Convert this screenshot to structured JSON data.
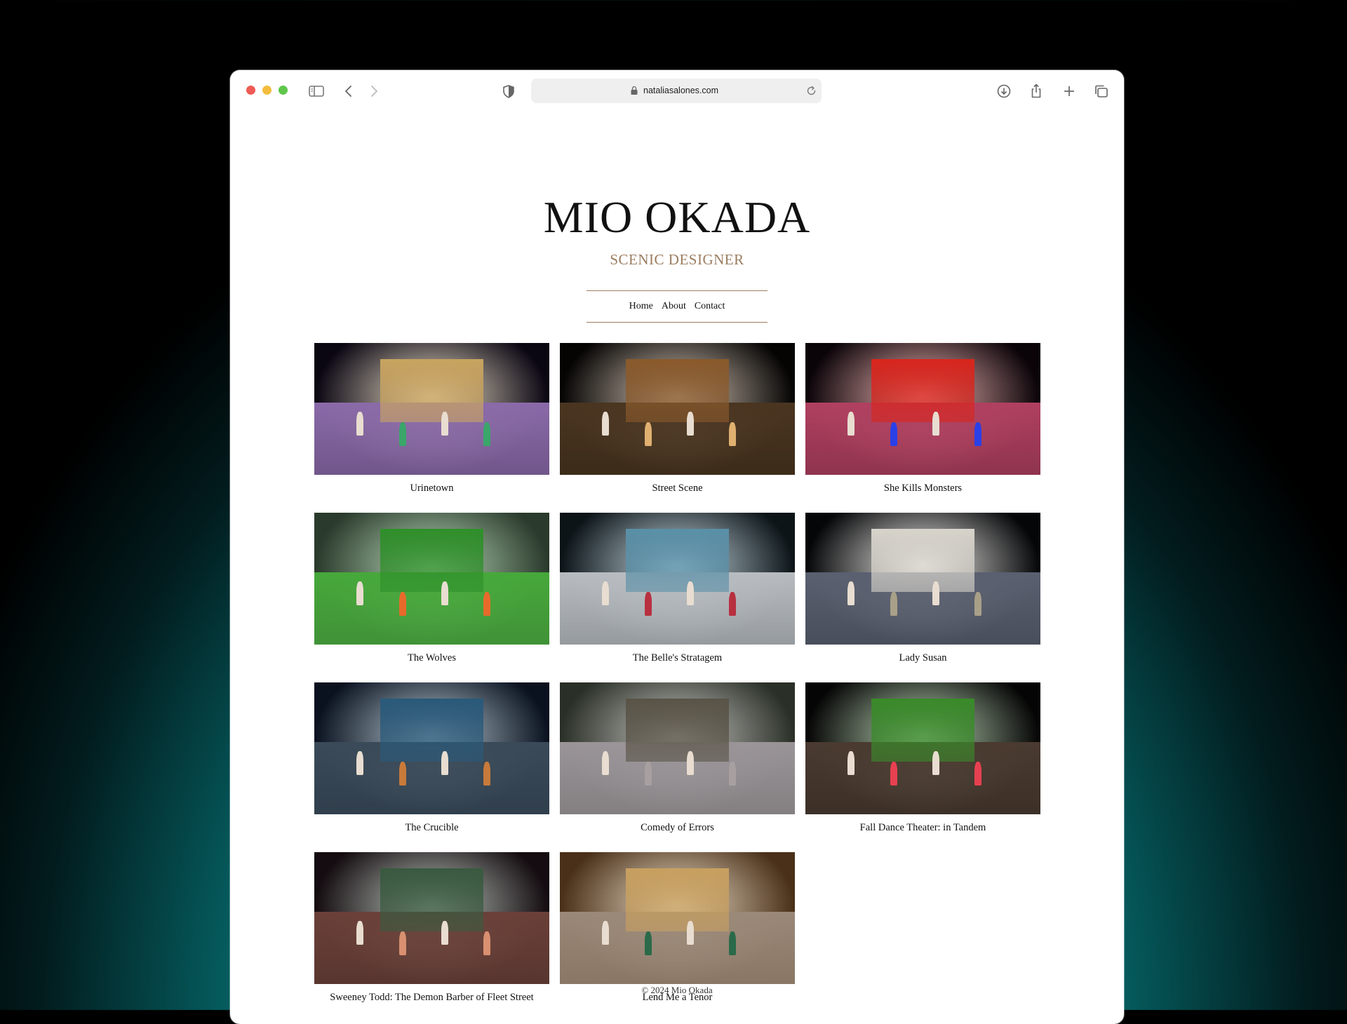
{
  "browser": {
    "url": "nataliasalones.com"
  },
  "site": {
    "title": "MIO OKADA",
    "subtitle": "SCENIC DESIGNER"
  },
  "nav": {
    "items": [
      "Home",
      "About",
      "Contact"
    ]
  },
  "productions": [
    {
      "title": "Urinetown",
      "palette": {
        "sky": "#0a0612",
        "stage": "#8a6aa8",
        "set": "#c9a460",
        "accent": "#3aa66a"
      }
    },
    {
      "title": "Street Scene",
      "palette": {
        "sky": "#050403",
        "stage": "#4a3520",
        "set": "#8a5a2c",
        "accent": "#e0b070"
      }
    },
    {
      "title": "She Kills Monsters",
      "palette": {
        "sky": "#0a0308",
        "stage": "#b04060",
        "set": "#d8261e",
        "accent": "#2a40e8"
      }
    },
    {
      "title": "The Wolves",
      "palette": {
        "sky": "#2a3a2c",
        "stage": "#46a83a",
        "set": "#2f8f2a",
        "accent": "#e86a2a"
      }
    },
    {
      "title": "The Belle's Stratagem",
      "palette": {
        "sky": "#0c1418",
        "stage": "#b8bcc0",
        "set": "#5a90a8",
        "accent": "#b83040"
      }
    },
    {
      "title": "Lady Susan",
      "palette": {
        "sky": "#050608",
        "stage": "#5a6070",
        "set": "#d8d4cc",
        "accent": "#a8a088"
      }
    },
    {
      "title": "The Crucible",
      "palette": {
        "sky": "#0a1220",
        "stage": "#3a4a58",
        "set": "#2a5a7a",
        "accent": "#c87a3a"
      }
    },
    {
      "title": "Comedy of Errors",
      "palette": {
        "sky": "#2a3028",
        "stage": "#9a9498",
        "set": "#5a5448",
        "accent": "#a8a0a0"
      }
    },
    {
      "title": "Fall Dance Theater: in Tandem",
      "palette": {
        "sky": "#050505",
        "stage": "#4a3a30",
        "set": "#3a8a2a",
        "accent": "#e84050"
      }
    },
    {
      "title": "Sweeney Todd: The Demon Barber of Fleet Street",
      "palette": {
        "sky": "#140c10",
        "stage": "#6a4038",
        "set": "#3a5a40",
        "accent": "#d89070"
      }
    },
    {
      "title": "Lend Me a Tenor",
      "palette": {
        "sky": "#4a3018",
        "stage": "#9a8878",
        "set": "#c8a060",
        "accent": "#2a6a4a"
      }
    }
  ],
  "footer": {
    "copyright": "© 2024 Mio Okada"
  }
}
